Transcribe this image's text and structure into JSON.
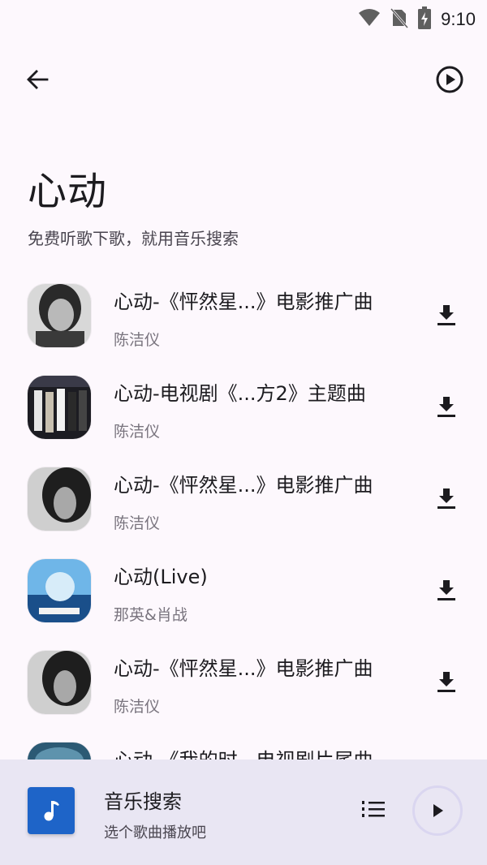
{
  "status_bar": {
    "time": "9:10",
    "icons": [
      "wifi-icon",
      "no-sim-icon",
      "battery-charging-icon"
    ]
  },
  "header": {
    "back_icon": "arrow-left-icon",
    "play_all_icon": "play-circle-icon",
    "title": "心动",
    "subtitle": "免费听歌下歌，就用音乐搜索"
  },
  "songs": [
    {
      "title": "心动-《怦然星...》电影推广曲",
      "artist": "陈洁仪"
    },
    {
      "title": "心动-电视剧《...方2》主题曲",
      "artist": "陈洁仪"
    },
    {
      "title": "心动-《怦然星...》电影推广曲",
      "artist": "陈洁仪"
    },
    {
      "title": "心动(Live)",
      "artist": "那英&肖战"
    },
    {
      "title": "心动-《怦然星...》电影推广曲",
      "artist": "陈洁仪"
    },
    {
      "title": "心动-《我的时...电视剧片尾曲",
      "artist": ""
    }
  ],
  "player": {
    "title": "音乐搜索",
    "subtitle": "选个歌曲播放吧",
    "cover_icon": "music-note-icon",
    "queue_icon": "queue-list-icon",
    "play_icon": "play-icon"
  },
  "colors": {
    "background": "#fdf8fd",
    "player_bg": "#e9e6f3",
    "cover_blue": "#1e64c8"
  }
}
